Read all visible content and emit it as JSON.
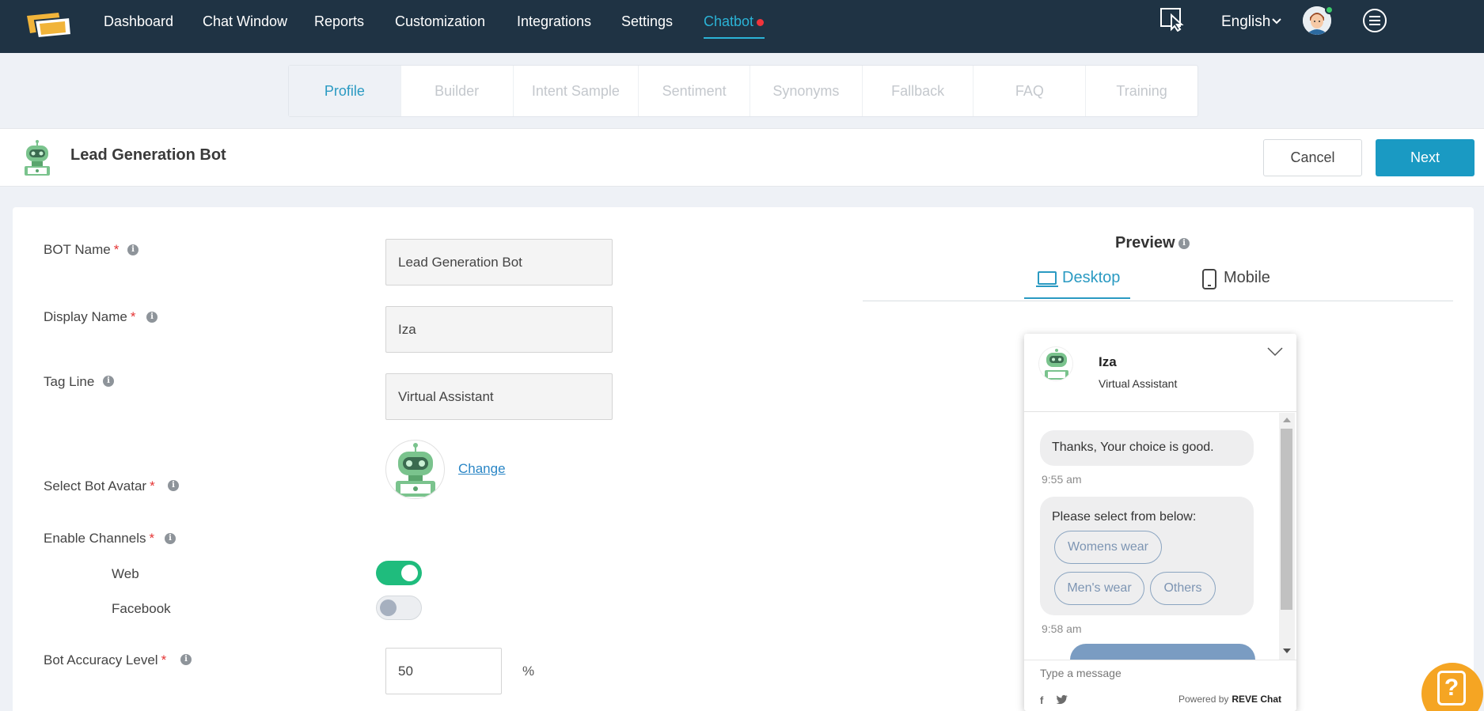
{
  "nav": {
    "items": [
      {
        "label": "Dashboard"
      },
      {
        "label": "Chat Window"
      },
      {
        "label": "Reports"
      },
      {
        "label": "Customization"
      },
      {
        "label": "Integrations"
      },
      {
        "label": "Settings"
      },
      {
        "label": "Chatbot"
      }
    ],
    "active": "Chatbot",
    "language": "English",
    "icons": [
      "cursor-select-icon",
      "chevron-down-icon",
      "user-avatar",
      "menu-icon"
    ]
  },
  "subtabs": {
    "items": [
      {
        "label": "Profile"
      },
      {
        "label": "Builder"
      },
      {
        "label": "Intent Sample"
      },
      {
        "label": "Sentiment"
      },
      {
        "label": "Synonyms"
      },
      {
        "label": "Fallback"
      },
      {
        "label": "FAQ"
      },
      {
        "label": "Training"
      }
    ],
    "active": "Profile"
  },
  "header": {
    "title": "Lead Generation Bot",
    "cancel_label": "Cancel",
    "next_label": "Next"
  },
  "form": {
    "bot_name": {
      "label": "BOT Name",
      "required": "*",
      "value": "Lead Generation Bot"
    },
    "display_name": {
      "label": "Display Name",
      "required": "*",
      "value": "Iza"
    },
    "tag_line": {
      "label": "Tag Line",
      "value": "Virtual Assistant"
    },
    "avatar": {
      "label": "Select Bot Avatar",
      "required": "*",
      "change_label": "Change"
    },
    "channels": {
      "label": "Enable Channels",
      "required": "*",
      "items": [
        {
          "label": "Web",
          "enabled": true
        },
        {
          "label": "Facebook",
          "enabled": false
        }
      ]
    },
    "accuracy": {
      "label": "Bot Accuracy Level",
      "required": "*",
      "value": "50",
      "unit": "%"
    }
  },
  "preview": {
    "title": "Preview",
    "tabs": [
      {
        "label": "Desktop"
      },
      {
        "label": "Mobile"
      }
    ],
    "active_tab": "Desktop",
    "widget": {
      "name": "Iza",
      "tagline": "Virtual Assistant",
      "messages": [
        {
          "text": "Thanks, Your choice is good.",
          "time": "9:55 am"
        },
        {
          "text": "Please select from below:",
          "time": "9:58 am",
          "options": [
            "Womens wear",
            "Men's wear",
            "Others"
          ]
        }
      ],
      "input_placeholder": "Type a message",
      "powered_by": "Powered by",
      "brand": "REVE Chat"
    }
  },
  "colors": {
    "nav_bg": "#1f3344",
    "accent": "#2a9ac2",
    "primary_button": "#1a9ac3",
    "toggle_on": "#1fbc7d",
    "required": "#e53434",
    "help": "#f5a523"
  }
}
